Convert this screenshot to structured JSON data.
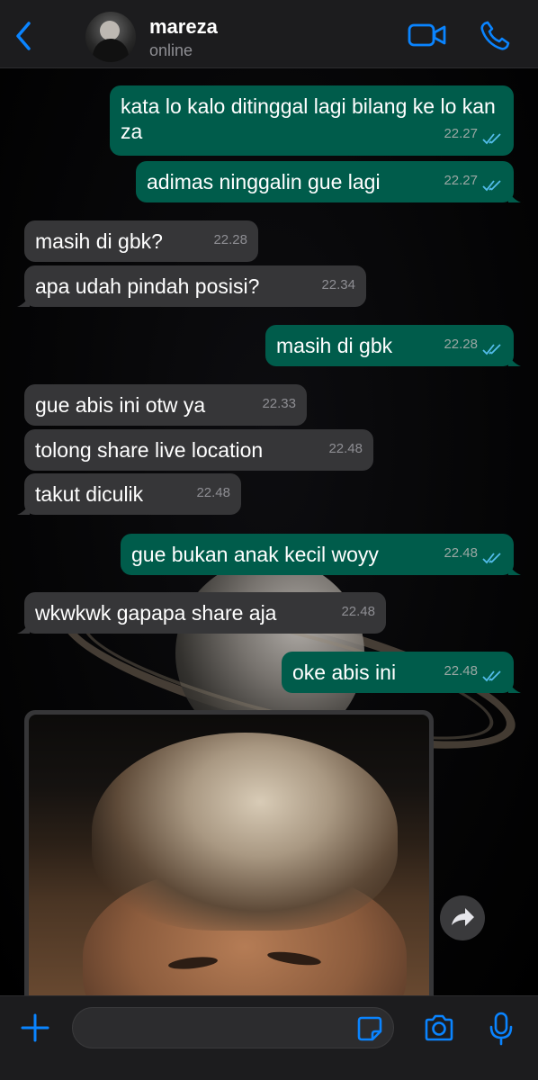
{
  "header": {
    "contact_name": "mareza",
    "contact_status": "online",
    "icons": [
      "back-chevron-icon",
      "video-call-icon",
      "phone-call-icon"
    ]
  },
  "messages": [
    {
      "dir": "out",
      "text": "kata lo kalo ditinggal lagi bilang ke lo kan za",
      "time": "22.27",
      "read": true
    },
    {
      "dir": "out",
      "text": "adimas ninggalin gue lagi",
      "time": "22.27",
      "read": true
    },
    {
      "dir": "in",
      "text": "masih di gbk?",
      "time": "22.28"
    },
    {
      "dir": "in",
      "text": "apa udah pindah posisi?",
      "time": "22.34"
    },
    {
      "dir": "out",
      "text": "masih di gbk",
      "time": "22.28",
      "read": true
    },
    {
      "dir": "in",
      "text": "gue abis ini otw ya",
      "time": "22.33"
    },
    {
      "dir": "in",
      "text": "tolong share live location",
      "time": "22.48"
    },
    {
      "dir": "in",
      "text": "takut diculik",
      "time": "22.48"
    },
    {
      "dir": "out",
      "text": "gue bukan anak kecil woyy",
      "time": "22.48",
      "read": true
    },
    {
      "dir": "in",
      "text": "wkwkwk gapapa share aja",
      "time": "22.48"
    },
    {
      "dir": "out",
      "text": "oke abis ini",
      "time": "22.48",
      "read": true
    }
  ],
  "photo_message": {
    "dir": "in",
    "icon": "forward-icon"
  },
  "input_bar": {
    "placeholder": "",
    "icons": [
      "plus-icon",
      "sticker-icon",
      "camera-icon",
      "microphone-icon"
    ]
  },
  "colors": {
    "accent": "#0a84ff",
    "outgoing_bubble": "#005c4b",
    "incoming_bubble": "#363638",
    "read_ticks": "#53bdeb"
  }
}
